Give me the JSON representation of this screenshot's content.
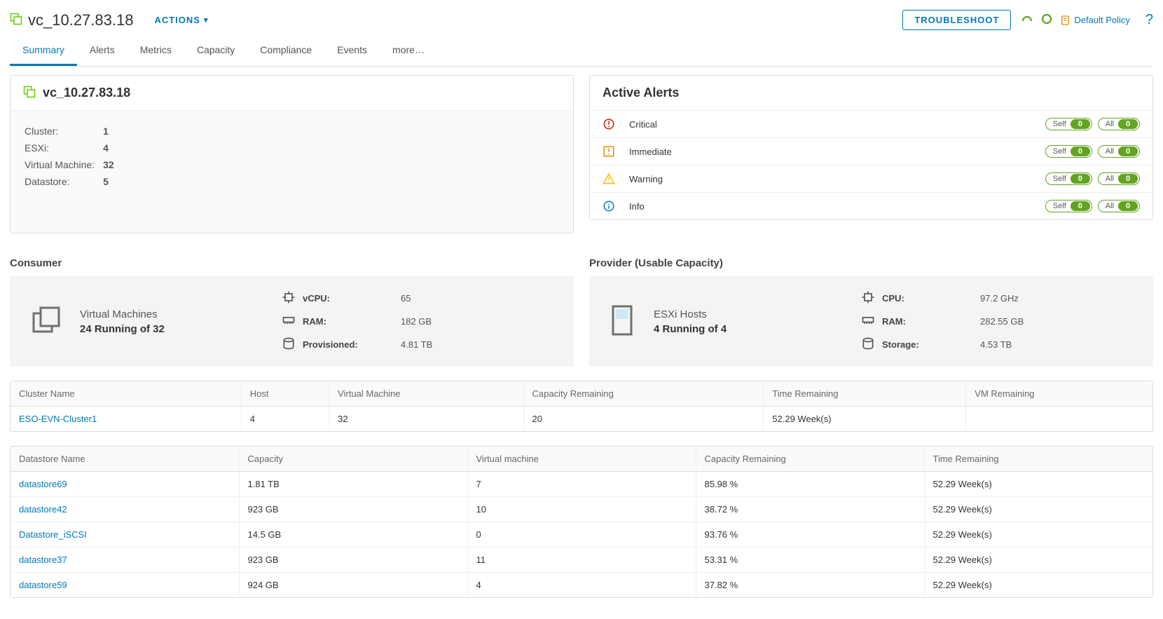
{
  "header": {
    "title": "vc_10.27.83.18",
    "actions": "ACTIONS",
    "troubleshoot": "TROUBLESHOOT",
    "policy": "Default Policy"
  },
  "tabs": [
    "Summary",
    "Alerts",
    "Metrics",
    "Capacity",
    "Compliance",
    "Events",
    "more…"
  ],
  "activeTab": 0,
  "summaryCard": {
    "title": "vc_10.27.83.18",
    "rows": [
      {
        "label": "Cluster:",
        "value": "1"
      },
      {
        "label": "ESXi:",
        "value": "4"
      },
      {
        "label": "Virtual Machine:",
        "value": "32"
      },
      {
        "label": "Datastore:",
        "value": "5"
      }
    ]
  },
  "alertsCard": {
    "title": "Active Alerts",
    "levels": [
      {
        "label": "Critical",
        "self": "0",
        "all": "0",
        "color": "#c92100",
        "kind": "critical"
      },
      {
        "label": "Immediate",
        "self": "0",
        "all": "0",
        "color": "#eb8d00",
        "kind": "immediate"
      },
      {
        "label": "Warning",
        "self": "0",
        "all": "0",
        "color": "#efc006",
        "kind": "warning"
      },
      {
        "label": "Info",
        "self": "0",
        "all": "0",
        "color": "#0079b8",
        "kind": "info"
      }
    ],
    "selfLabel": "Self",
    "allLabel": "All"
  },
  "consumer": {
    "sectionTitle": "Consumer",
    "headline": "Virtual Machines",
    "sub": "24 Running of 32",
    "metrics": [
      {
        "label": "vCPU:",
        "value": "65",
        "icon": "cpu"
      },
      {
        "label": "RAM:",
        "value": "182 GB",
        "icon": "ram"
      },
      {
        "label": "Provisioned:",
        "value": "4.81 TB",
        "icon": "storage"
      }
    ]
  },
  "provider": {
    "sectionTitle": "Provider (Usable Capacity)",
    "headline": "ESXi Hosts",
    "sub": "4 Running of 4",
    "metrics": [
      {
        "label": "CPU:",
        "value": "97.2 GHz",
        "icon": "cpu"
      },
      {
        "label": "RAM:",
        "value": "282.55 GB",
        "icon": "ram"
      },
      {
        "label": "Storage:",
        "value": "4.53 TB",
        "icon": "storage"
      }
    ]
  },
  "clusterTable": {
    "cols": [
      "Cluster Name",
      "Host",
      "Virtual Machine",
      "Capacity Remaining",
      "Time Remaining",
      "VM Remaining"
    ],
    "rows": [
      {
        "cells": [
          "ESO-EVN-Cluster1",
          "4",
          "32",
          "20",
          "52.29 Week(s)",
          ""
        ],
        "link": 0
      }
    ]
  },
  "datastoreTable": {
    "cols": [
      "Datastore Name",
      "Capacity",
      "Virtual machine",
      "Capacity Remaining",
      "Time Remaining"
    ],
    "widths": [
      "20%",
      "20%",
      "20%",
      "20%",
      "20%"
    ],
    "rows": [
      {
        "cells": [
          "datastore69",
          "1.81 TB",
          "7",
          "85.98 %",
          "52.29 Week(s)"
        ],
        "link": 0
      },
      {
        "cells": [
          "datastore42",
          "923 GB",
          "10",
          "38.72 %",
          "52.29 Week(s)"
        ],
        "link": 0
      },
      {
        "cells": [
          "Datastore_iSCSI",
          "14.5 GB",
          "0",
          "93.76 %",
          "52.29 Week(s)"
        ],
        "link": 0
      },
      {
        "cells": [
          "datastore37",
          "923 GB",
          "11",
          "53.31 %",
          "52.29 Week(s)"
        ],
        "link": 0
      },
      {
        "cells": [
          "datastore59",
          "924 GB",
          "4",
          "37.82 %",
          "52.29 Week(s)"
        ],
        "link": 0
      }
    ]
  }
}
